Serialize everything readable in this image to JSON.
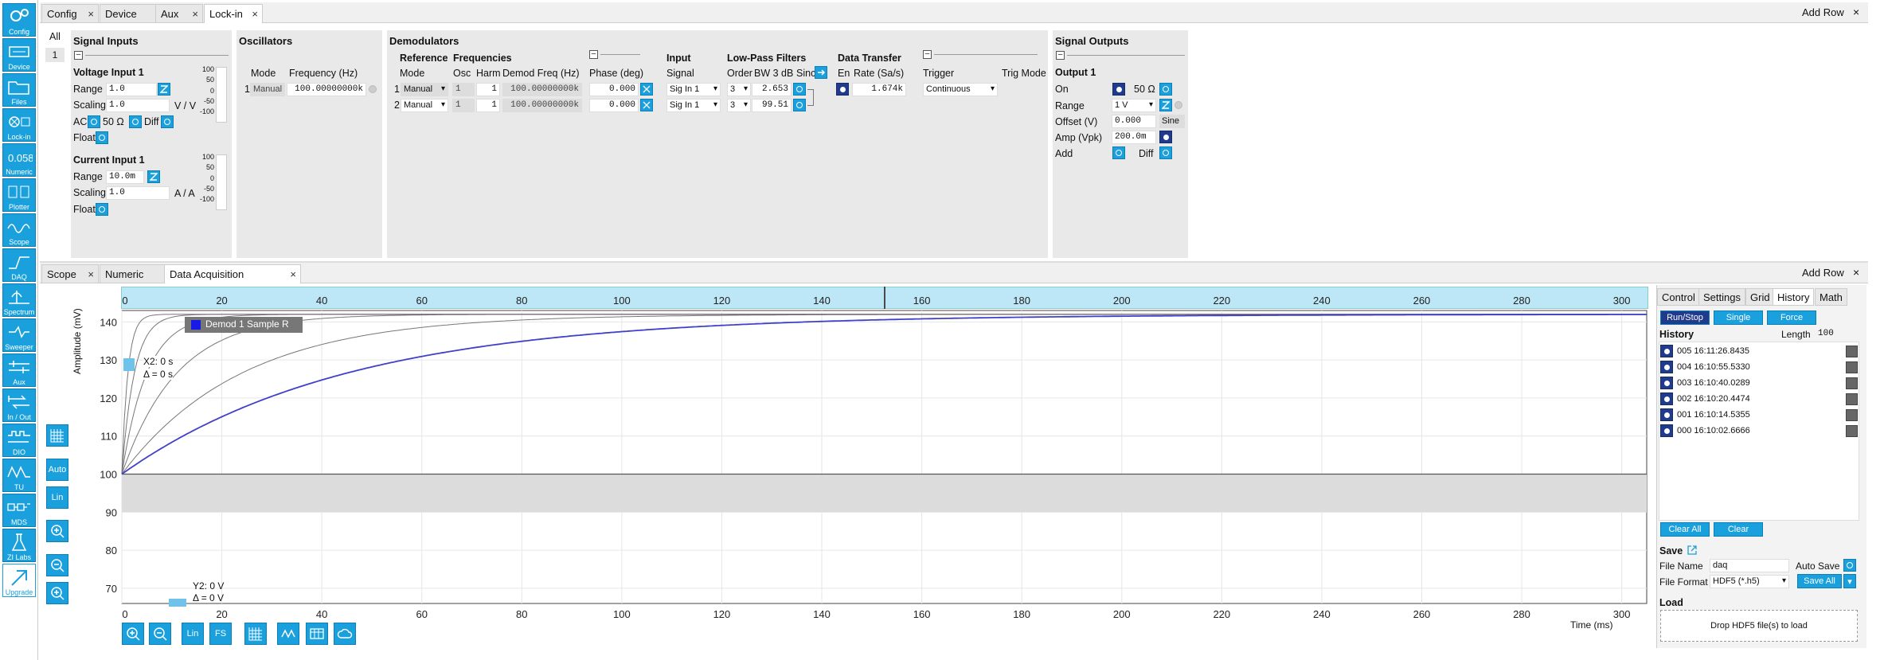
{
  "sidebar": {
    "items": [
      {
        "label": "Config",
        "icon": "gears-icon"
      },
      {
        "label": "Device",
        "icon": "device-icon"
      },
      {
        "label": "Files",
        "icon": "folder-icon"
      },
      {
        "label": "Lock-in",
        "icon": "lockin-icon"
      },
      {
        "label": "Numeric",
        "icon": "numeric-icon"
      },
      {
        "label": "Plotter",
        "icon": "plotter-icon"
      },
      {
        "label": "Scope",
        "icon": "scope-icon"
      },
      {
        "label": "DAQ",
        "icon": "daq-icon"
      },
      {
        "label": "Spectrum",
        "icon": "spectrum-icon"
      },
      {
        "label": "Sweeper",
        "icon": "sweeper-icon"
      },
      {
        "label": "Aux",
        "icon": "aux-icon"
      },
      {
        "label": "In / Out",
        "icon": "inout-icon"
      },
      {
        "label": "DIO",
        "icon": "dio-icon"
      },
      {
        "label": "TU",
        "icon": "tu-icon"
      },
      {
        "label": "MDS",
        "icon": "mds-icon"
      },
      {
        "label": "ZI Labs",
        "icon": "flask-icon"
      },
      {
        "label": "Upgrade",
        "icon": "upgrade-icon"
      }
    ]
  },
  "top_tabs": [
    "Config",
    "Device",
    "Aux",
    "Lock-in"
  ],
  "bottom_tabs": [
    "Scope",
    "Numeric",
    "Data Acquisition"
  ],
  "add_row": "Add Row",
  "all_label": "All",
  "row_num": "1",
  "signal_inputs": {
    "title": "Signal Inputs",
    "voltage_title": "Voltage Input 1",
    "range_label": "Range",
    "range_value": "1.0",
    "scaling_label": "Scaling",
    "scaling_value": "1.0",
    "unit": "V / V",
    "ac_label": "AC",
    "ohm_label": "50 Ω",
    "diff_label": "Diff",
    "float_label": "Float",
    "current_title": "Current Input 1",
    "c_range_value": "10.0m",
    "c_scaling_value": "1.0",
    "c_unit": "A / A",
    "scale_ticks": [
      "100",
      "50",
      "0",
      "-50",
      "-100"
    ]
  },
  "oscillators": {
    "title": "Oscillators",
    "mode_label": "Mode",
    "freq_label": "Frequency (Hz)",
    "row": "1",
    "mode": "Manual",
    "freq": "100.00000000k"
  },
  "demodulators": {
    "title": "Demodulators",
    "reference": "Reference",
    "frequencies": "Frequencies",
    "mode_label": "Mode",
    "osc_label": "Osc",
    "harm_label": "Harm",
    "demod_freq_label": "Demod Freq (Hz)",
    "phase_label": "Phase (deg)",
    "input": "Input",
    "signal_label": "Signal",
    "lpf": "Low-Pass Filters",
    "order_label": "Order",
    "bw_label": "BW 3 dB",
    "sinc_label": "Sinc",
    "data_transfer": "Data Transfer",
    "en_label": "En",
    "rate_label": "Rate (Sa/s)",
    "trigger": "Trigger",
    "trig_mode_label": "Trig Mode",
    "rows": [
      {
        "n": "1",
        "mode": "Manual",
        "osc": "1",
        "harm": "1",
        "freq": "100.00000000k",
        "phase": "0.000",
        "signal": "Sig In 1",
        "order": "3",
        "bw": "2.653",
        "rate": "1.674k",
        "trig": "Continuous"
      },
      {
        "n": "2",
        "mode": "Manual",
        "osc": "1",
        "harm": "1",
        "freq": "100.00000000k",
        "phase": "0.000",
        "signal": "Sig In 1",
        "order": "3",
        "bw": "99.51"
      }
    ]
  },
  "signal_outputs": {
    "title": "Signal Outputs",
    "output_title": "Output 1",
    "on_label": "On",
    "ohm_label": "50 Ω",
    "range_label": "Range",
    "range_value": "1 V",
    "offset_label": "Offset (V)",
    "offset_value": "0.000",
    "sine_label": "Sine",
    "amp_label": "Amp (Vpk)",
    "amp_value": "200.0m",
    "add_label": "Add",
    "diff_label": "Diff"
  },
  "plot": {
    "ylabel": "Amplitude (mV)",
    "xlabel": "Time (ms)",
    "legend": "Demod 1 Sample R",
    "cursor_x": "X2: 0 s",
    "cursor_x_delta": "Δ = 0 s",
    "cursor_y": "Y2: 0 V",
    "cursor_y_delta": "Δ = 0 V",
    "left_tools": [
      "Auto",
      "Lin"
    ],
    "bottom_tools": [
      "Lin",
      "FS"
    ]
  },
  "chart_data": {
    "type": "line",
    "xlabel": "Time (ms)",
    "ylabel": "Amplitude (mV)",
    "xlim": [
      0,
      305
    ],
    "ylim": [
      66,
      143
    ],
    "x_ticks": [
      0,
      20,
      40,
      60,
      80,
      100,
      120,
      140,
      160,
      180,
      200,
      220,
      240,
      260,
      280,
      300
    ],
    "y_ticks": [
      70,
      80,
      90,
      100,
      110,
      120,
      130,
      140
    ],
    "series": [
      {
        "name": "Demod 1 Sample R",
        "color": "#4040c8",
        "tau": 45,
        "y0": 100,
        "yinf": 142
      },
      {
        "color": "#777777",
        "tau": 24,
        "y0": 100,
        "yinf": 142
      },
      {
        "color": "#777777",
        "tau": 11,
        "y0": 100,
        "yinf": 142
      },
      {
        "color": "#777777",
        "tau": 5,
        "y0": 100,
        "yinf": 142
      },
      {
        "color": "#777777",
        "tau": 2.5,
        "y0": 100,
        "yinf": 142
      },
      {
        "color": "#777777",
        "tau": 1.2,
        "y0": 100,
        "yinf": 142
      }
    ]
  },
  "right_panel": {
    "tabs": [
      "Control",
      "Settings",
      "Grid",
      "History",
      "Math"
    ],
    "run_stop": "Run/Stop",
    "single": "Single",
    "force": "Force",
    "history_label": "History",
    "length_label": "Length",
    "length_value": "100",
    "history": [
      "005 16:11:26.8435",
      "004 16:10:55.5330",
      "003 16:10:40.0289",
      "002 16:10:20.4474",
      "001 16:10:14.5355",
      "000 16:10:02.6666"
    ],
    "clear_all": "Clear All",
    "clear": "Clear",
    "save_label": "Save",
    "file_name_label": "File Name",
    "file_name": "daq",
    "auto_save": "Auto Save",
    "file_format_label": "File Format",
    "file_format": "HDF5 (*.h5)",
    "save_all": "Save All",
    "load_label": "Load",
    "drop_text": "Drop HDF5 file(s) to load"
  }
}
